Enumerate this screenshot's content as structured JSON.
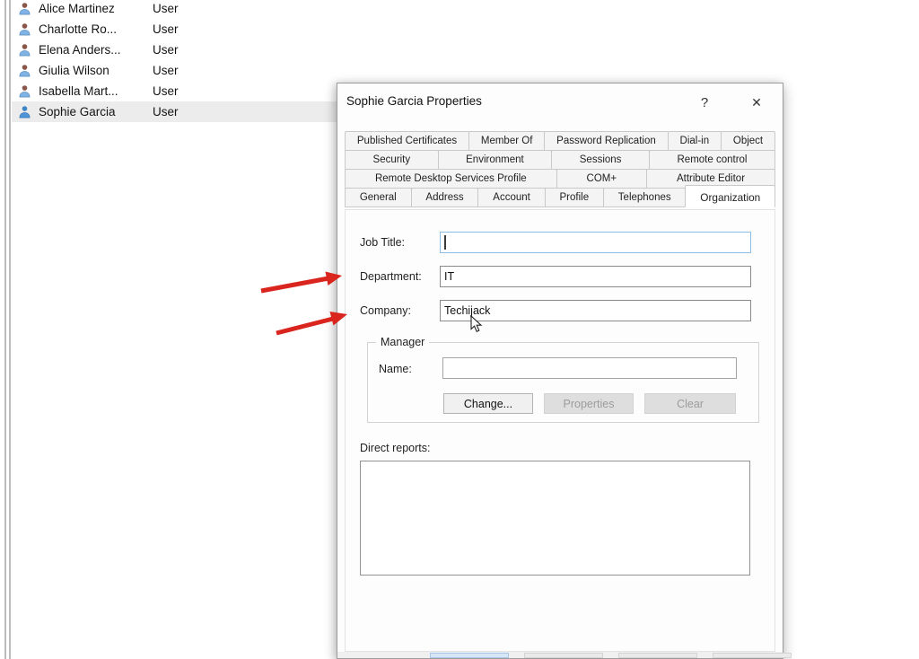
{
  "user_list": {
    "items": [
      {
        "name": "Alice Martinez",
        "type": "User"
      },
      {
        "name": "Charlotte Ro...",
        "type": "User"
      },
      {
        "name": "Elena Anders...",
        "type": "User"
      },
      {
        "name": "Giulia Wilson",
        "type": "User"
      },
      {
        "name": "Isabella Mart...",
        "type": "User"
      },
      {
        "name": "Sophie Garcia",
        "type": "User"
      }
    ]
  },
  "dialog": {
    "title": "Sophie Garcia Properties",
    "help_glyph": "?",
    "close_glyph": "✕",
    "tab_rows": [
      [
        "Published Certificates",
        "Member Of",
        "Password Replication",
        "Dial-in",
        "Object"
      ],
      [
        "Security",
        "Environment",
        "Sessions",
        "Remote control"
      ],
      [
        "Remote Desktop Services Profile",
        "COM+",
        "Attribute Editor"
      ],
      [
        "General",
        "Address",
        "Account",
        "Profile",
        "Telephones",
        "Organization"
      ]
    ],
    "active_tab": "Organization",
    "fields": {
      "job_title_label": "Job Title:",
      "job_title_value": "",
      "department_label": "Department:",
      "department_value": "IT",
      "company_label": "Company:",
      "company_value": "Techijack"
    },
    "manager": {
      "group_label": "Manager",
      "name_label": "Name:",
      "name_value": "",
      "change_button": "Change...",
      "properties_button": "Properties",
      "clear_button": "Clear"
    },
    "direct_reports_label": "Direct reports:"
  },
  "colors": {
    "arrow_red": "#d9251d",
    "focus_border": "#8ebde4",
    "selected_row": "#ececec"
  }
}
